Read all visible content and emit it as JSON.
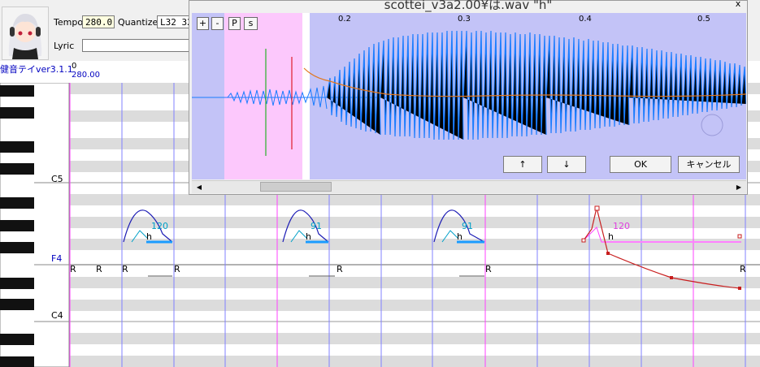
{
  "toolbar": {
    "tempo_label": "Tempo",
    "tempo_value": "280.0",
    "quantize_label": "Quantize",
    "quantize_value": "L32 32",
    "lyric_label": "Lyric",
    "lyric_value": ""
  },
  "track": {
    "singer": "健音テイver3.1.1",
    "position": "0",
    "tempo": "280.00"
  },
  "piano": {
    "c5_label": "C5",
    "f4_label": "F4",
    "c4_label": "C4"
  },
  "notes": {
    "rest_label": "R",
    "lyric": "h",
    "note1_value": "120",
    "note2_value": "91",
    "note3_value": "91",
    "note4_value": "120"
  },
  "wave_window": {
    "title": "scottei_v3a2.00¥は.wav \"h\"",
    "close_label": "x",
    "btn_plus": "+",
    "btn_minus": "-",
    "btn_p": "P",
    "btn_s": "s",
    "ruler": [
      "0.2",
      "0.3",
      "0.4",
      "0.5"
    ],
    "up_label": "↑",
    "down_label": "↓",
    "ok_label": "OK",
    "cancel_label": "キャンセル",
    "scroll_left": "◀",
    "scroll_right": "▶"
  },
  "colors": {
    "waveform": "#1a7cff",
    "selection": "#fcc8fc",
    "wave_bg": "#c3c3f7",
    "pitch_curve": "#c81e1e",
    "envelope": "#1d1db5",
    "singer_text": "#0000c0"
  }
}
